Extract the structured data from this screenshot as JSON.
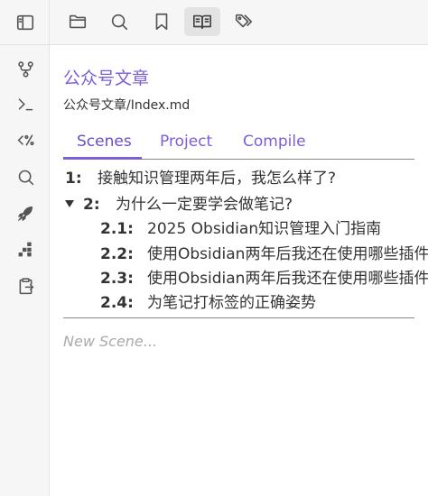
{
  "toolbar": {
    "left_icon": "sidebar-toggle-icon",
    "icons": [
      "folder-icon",
      "search-icon",
      "bookmark-icon",
      "book-open-icon",
      "tags-icon"
    ],
    "active": "book-open-icon"
  },
  "ribbon": {
    "icons": [
      "git-branch-icon",
      "terminal-icon",
      "template-icon",
      "search-icon",
      "rocket-icon",
      "blocks-icon",
      "clipboard-export-icon"
    ]
  },
  "header": {
    "title": "公众号文章",
    "path": "公众号文章/Index.md"
  },
  "tabs": [
    {
      "label": "Scenes",
      "active": true
    },
    {
      "label": "Project",
      "active": false
    },
    {
      "label": "Compile",
      "active": false
    }
  ],
  "scenes": [
    {
      "number": "1:",
      "title": "接触知识管理两年后，我怎么样了?"
    },
    {
      "number": "2:",
      "title": "为什么一定要学会做笔记?",
      "expanded": true
    },
    {
      "number": "2.1:",
      "title": "2025 Obsidian知识管理入门指南"
    },
    {
      "number": "2.2:",
      "title": "使用Obsidian两年后我还在使用哪些插件"
    },
    {
      "number": "2.3:",
      "title": "使用Obsidian两年后我还在使用哪些插件"
    },
    {
      "number": "2.4:",
      "title": "为笔记打标签的正确姿势"
    }
  ],
  "new_scene_placeholder": "New Scene...",
  "colors": {
    "accent": "#7c5ed6",
    "ribbon_bg": "#f6f6f6",
    "icon": "#555555"
  }
}
